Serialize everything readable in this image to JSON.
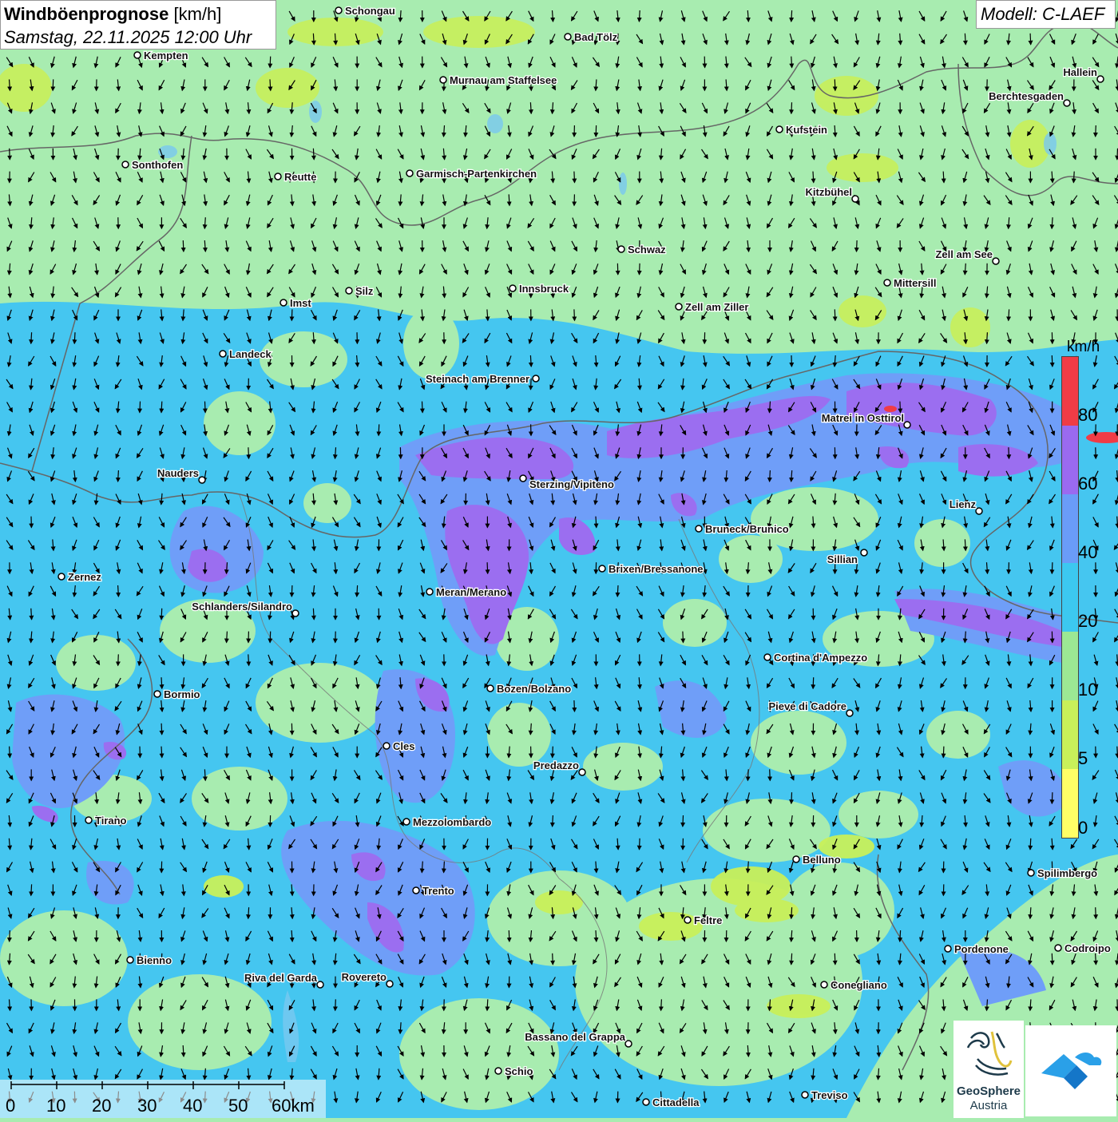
{
  "header": {
    "title_bold": "Windböenprognose",
    "title_unit": " [km/h]",
    "subtitle": "Samstag, 22.11.2025 12:00 Uhr"
  },
  "model": {
    "label": "Modell: C-LAEF"
  },
  "legend": {
    "unit": "km/h",
    "ticks": [
      "0",
      "5",
      "10",
      "20",
      "40",
      "60",
      "80"
    ],
    "colors": [
      "#ffff66",
      "#c8f05a",
      "#9ce894",
      "#3cc8f0",
      "#6a9cf8",
      "#9a6af0",
      "#f03c46"
    ]
  },
  "scale_bar": {
    "ticks": [
      "0",
      "10",
      "20",
      "30",
      "40",
      "50",
      "60km"
    ]
  },
  "logos": {
    "geosphere_line1": "GeoSphere",
    "geosphere_line2": "Austria",
    "logo_icon": "geosphere-icon",
    "app_icon": "wind-app-icon"
  },
  "colors": {
    "calm": "#ffff66",
    "light": "#c8f05a",
    "moderate": "#a8ecb0",
    "fresh": "#45c6f0",
    "strong": "#6f9ef8",
    "stormy": "#9b6ef0",
    "storm": "#f03c46"
  },
  "cities": [
    {
      "name": "Schongau"
    },
    {
      "name": "Bad Tölz"
    },
    {
      "name": "Kempten"
    },
    {
      "name": "Murnau am Staffelsee"
    },
    {
      "name": "Hallein"
    },
    {
      "name": "Berchtesgaden"
    },
    {
      "name": "Kufstein"
    },
    {
      "name": "Sonthofen"
    },
    {
      "name": "Reutte"
    },
    {
      "name": "Garmisch-Partenkirchen"
    },
    {
      "name": "Kitzbühel"
    },
    {
      "name": "Schwaz"
    },
    {
      "name": "Zell am See"
    },
    {
      "name": "Mittersill"
    },
    {
      "name": "Innsbruck"
    },
    {
      "name": "Silz"
    },
    {
      "name": "Imst"
    },
    {
      "name": "Zell am Ziller"
    },
    {
      "name": "Landeck"
    },
    {
      "name": "Steinach am Brenner"
    },
    {
      "name": "Matrei in Osttirol"
    },
    {
      "name": "Nauders"
    },
    {
      "name": "Sterzing/Vipiteno"
    },
    {
      "name": "Lienz"
    },
    {
      "name": "Bruneck/Brunico"
    },
    {
      "name": "Sillian"
    },
    {
      "name": "Brixen/Bressanone"
    },
    {
      "name": "Zernez"
    },
    {
      "name": "Meran/Merano"
    },
    {
      "name": "Schlanders/Silandro"
    },
    {
      "name": "Cortina d'Ampezzo"
    },
    {
      "name": "Bozen/Bolzano"
    },
    {
      "name": "Bormio"
    },
    {
      "name": "Pieve di Cadore"
    },
    {
      "name": "Cles"
    },
    {
      "name": "Predazzo"
    },
    {
      "name": "Tirano"
    },
    {
      "name": "Mezzolombardo"
    },
    {
      "name": "Belluno"
    },
    {
      "name": "Spilimbergo"
    },
    {
      "name": "Trento"
    },
    {
      "name": "Feltre"
    },
    {
      "name": "Pordenone"
    },
    {
      "name": "Codroipo"
    },
    {
      "name": "Bienno"
    },
    {
      "name": "Riva del Garda"
    },
    {
      "name": "Rovereto"
    },
    {
      "name": "Conegliano"
    },
    {
      "name": "Bassano del Grappa"
    },
    {
      "name": "Schio"
    },
    {
      "name": "Treviso"
    },
    {
      "name": "Cittadella"
    }
  ]
}
